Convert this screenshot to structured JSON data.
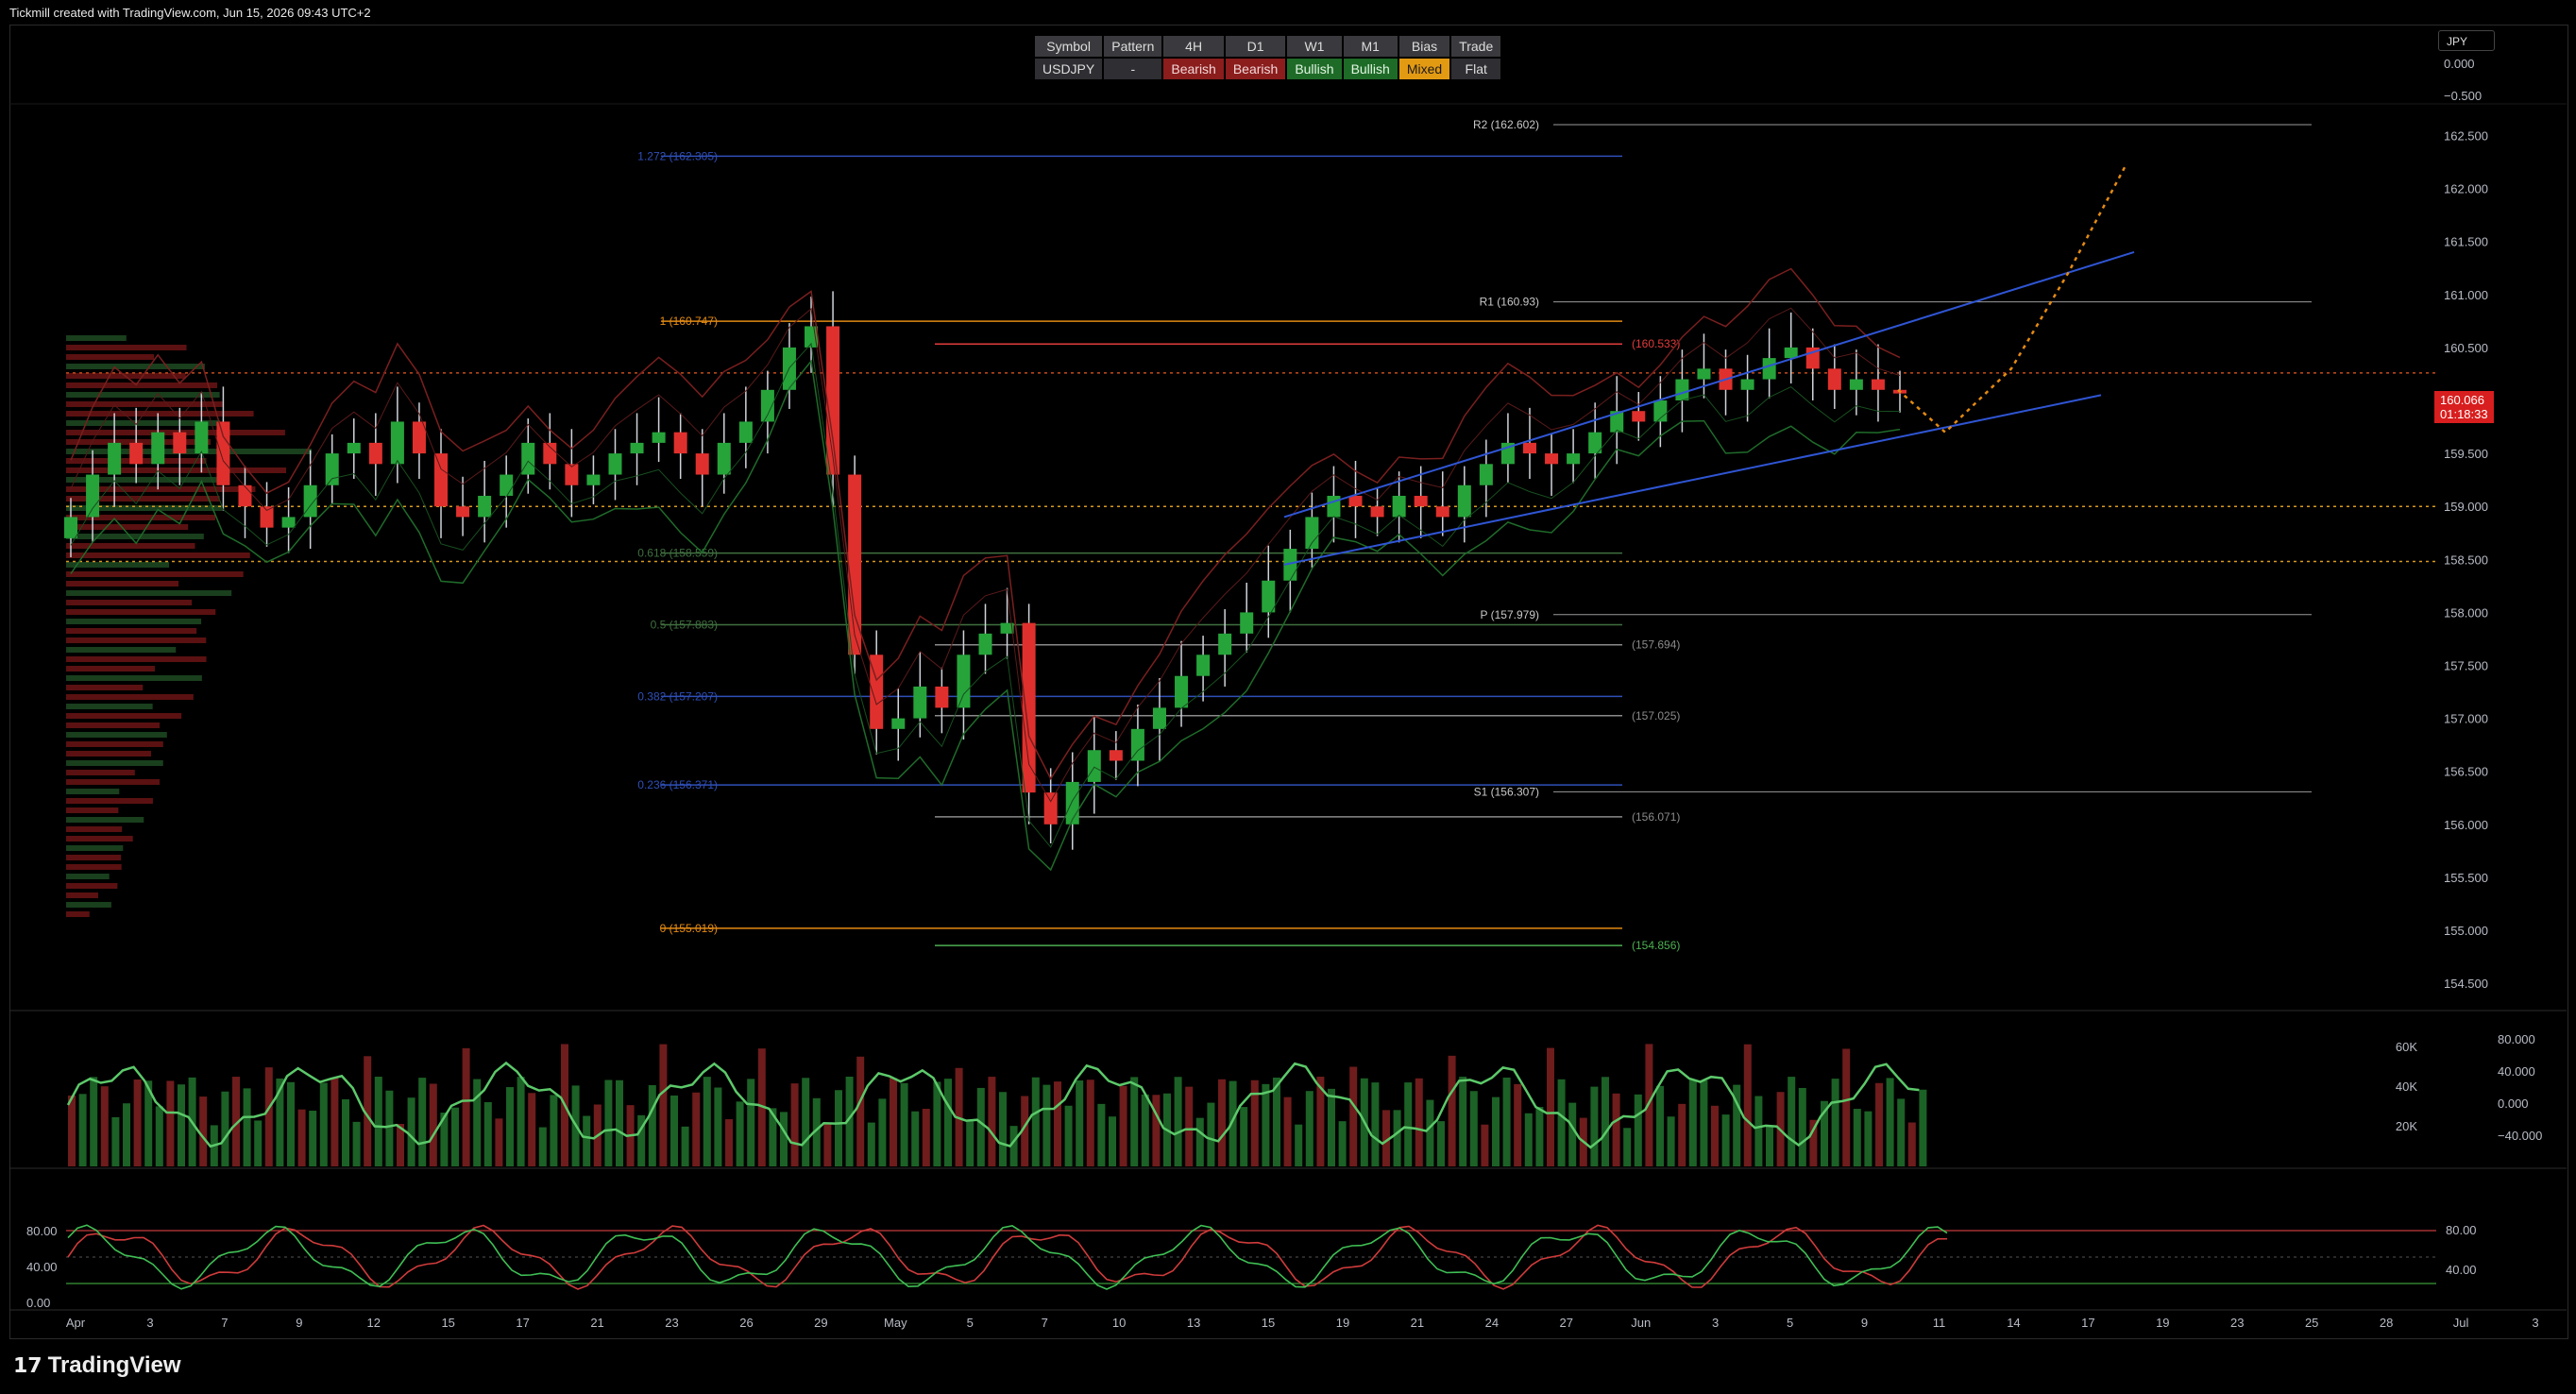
{
  "header": {
    "created_by": "Tickmill created with TradingView.com, Jun 15, 2026 09:43 UTC+2"
  },
  "branding": {
    "logo_text": "TradingView"
  },
  "signal_table": {
    "columns": [
      "Symbol",
      "Pattern",
      "4H",
      "D1",
      "W1",
      "M1",
      "Bias",
      "Trade"
    ],
    "values": [
      "USDJPY",
      "-",
      "Bearish",
      "Bearish",
      "Bullish",
      "Bullish",
      "Mixed",
      "Flat"
    ],
    "colors": {
      "Bearish": "#8b1d1d",
      "Bullish": "#1e6b27",
      "Mixed": "#e39a13"
    }
  },
  "currency_box": {
    "label": "JPY",
    "top_values": [
      "0.000",
      "−0.500"
    ]
  },
  "chart_data": {
    "type": "candlestick",
    "symbol": "USDJPY",
    "price_axis": {
      "ticks": [
        "162.500",
        "162.000",
        "161.500",
        "161.000",
        "160.500",
        "160.000",
        "159.500",
        "159.000",
        "158.500",
        "158.000",
        "157.500",
        "157.000",
        "156.500",
        "156.000",
        "155.500",
        "155.000",
        "154.500"
      ],
      "range": [
        154.25,
        162.97
      ]
    },
    "current_price": {
      "value": "160.066",
      "countdown": "01:18:33"
    },
    "time_axis": {
      "labels": [
        "Apr",
        "3",
        "7",
        "9",
        "12",
        "15",
        "17",
        "21",
        "23",
        "26",
        "29",
        "May",
        "5",
        "7",
        "10",
        "13",
        "15",
        "19",
        "21",
        "24",
        "27",
        "Jun",
        "3",
        "5",
        "9",
        "11",
        "14",
        "17",
        "19",
        "23",
        "25",
        "28",
        "Jul",
        "3"
      ]
    },
    "fib_levels": [
      {
        "label": "1.272 (162.305)",
        "value": 162.305,
        "color": "#2f4fb8"
      },
      {
        "label": "1 (160.747)",
        "value": 160.747,
        "color": "#e38a13"
      },
      {
        "label": "0.618 (158.559)",
        "value": 158.559,
        "color": "#3f6f3f"
      },
      {
        "label": "0.5 (157.883)",
        "value": 157.883,
        "color": "#3f6f3f"
      },
      {
        "label": "0.382 (157.207)",
        "value": 157.207,
        "color": "#2f4fb8"
      },
      {
        "label": "0.236 (156.371)",
        "value": 156.371,
        "color": "#2f4fb8"
      },
      {
        "label": "0 (155.019)",
        "value": 155.019,
        "color": "#e38a13"
      }
    ],
    "pivot_levels": [
      {
        "label": "R2 (162.602)",
        "value": 162.602
      },
      {
        "label": "R1 (160.93)",
        "value": 160.93
      },
      {
        "label": "P (157.979)",
        "value": 157.979
      },
      {
        "label": "S1 (156.307)",
        "value": 156.307
      }
    ],
    "other_levels": [
      {
        "label": "(160.533)",
        "value": 160.533,
        "color": "#e23b3b"
      },
      {
        "label": "(157.694)",
        "value": 157.694,
        "color": "#8a8a8a"
      },
      {
        "label": "(157.025)",
        "value": 157.025,
        "color": "#8a8a8a"
      },
      {
        "label": "(156.071)",
        "value": 156.071,
        "color": "#8a8a8a"
      },
      {
        "label": "(154.856)",
        "value": 154.856,
        "color": "#4caf50"
      }
    ],
    "dotted_levels": [
      160.26,
      159.0,
      158.48
    ],
    "channel": {
      "upper": [
        [
          158.9,
          161.4
        ]
      ],
      "lower": [
        [
          158.45,
          160.05
        ]
      ]
    },
    "closes": [
      158.9,
      159.3,
      159.6,
      159.4,
      159.7,
      159.5,
      159.8,
      159.2,
      159.0,
      158.8,
      158.9,
      159.2,
      159.5,
      159.6,
      159.4,
      159.8,
      159.5,
      159.0,
      158.9,
      159.1,
      159.3,
      159.6,
      159.4,
      159.2,
      159.3,
      159.5,
      159.6,
      159.7,
      159.5,
      159.3,
      159.6,
      159.8,
      160.1,
      160.5,
      160.7,
      159.3,
      157.6,
      156.9,
      157.0,
      157.3,
      157.1,
      157.6,
      157.8,
      157.9,
      156.3,
      156.0,
      156.4,
      156.7,
      156.6,
      156.9,
      157.1,
      157.4,
      157.6,
      157.8,
      158.0,
      158.3,
      158.6,
      158.9,
      159.1,
      159.0,
      158.9,
      159.1,
      159.0,
      158.9,
      159.2,
      159.4,
      159.6,
      159.5,
      159.4,
      159.5,
      159.7,
      159.9,
      159.8,
      160.0,
      160.2,
      160.3,
      160.1,
      160.2,
      160.4,
      160.5,
      160.3,
      160.1,
      160.2,
      160.1,
      160.066
    ],
    "projection": [
      160.1,
      159.7,
      160.3,
      161.2,
      162.2
    ],
    "indicator_panel_1": {
      "left_ticks": [],
      "right_ticks": [
        "80.000",
        "40.000",
        "0.000",
        "−40.000"
      ],
      "volume_ticks": [
        "60K",
        "40K",
        "20K"
      ]
    },
    "indicator_panel_2": {
      "left_ticks": [
        "80.00",
        "40.00",
        "0.00"
      ],
      "right_ticks": [
        "80.00",
        "40.00"
      ]
    }
  }
}
